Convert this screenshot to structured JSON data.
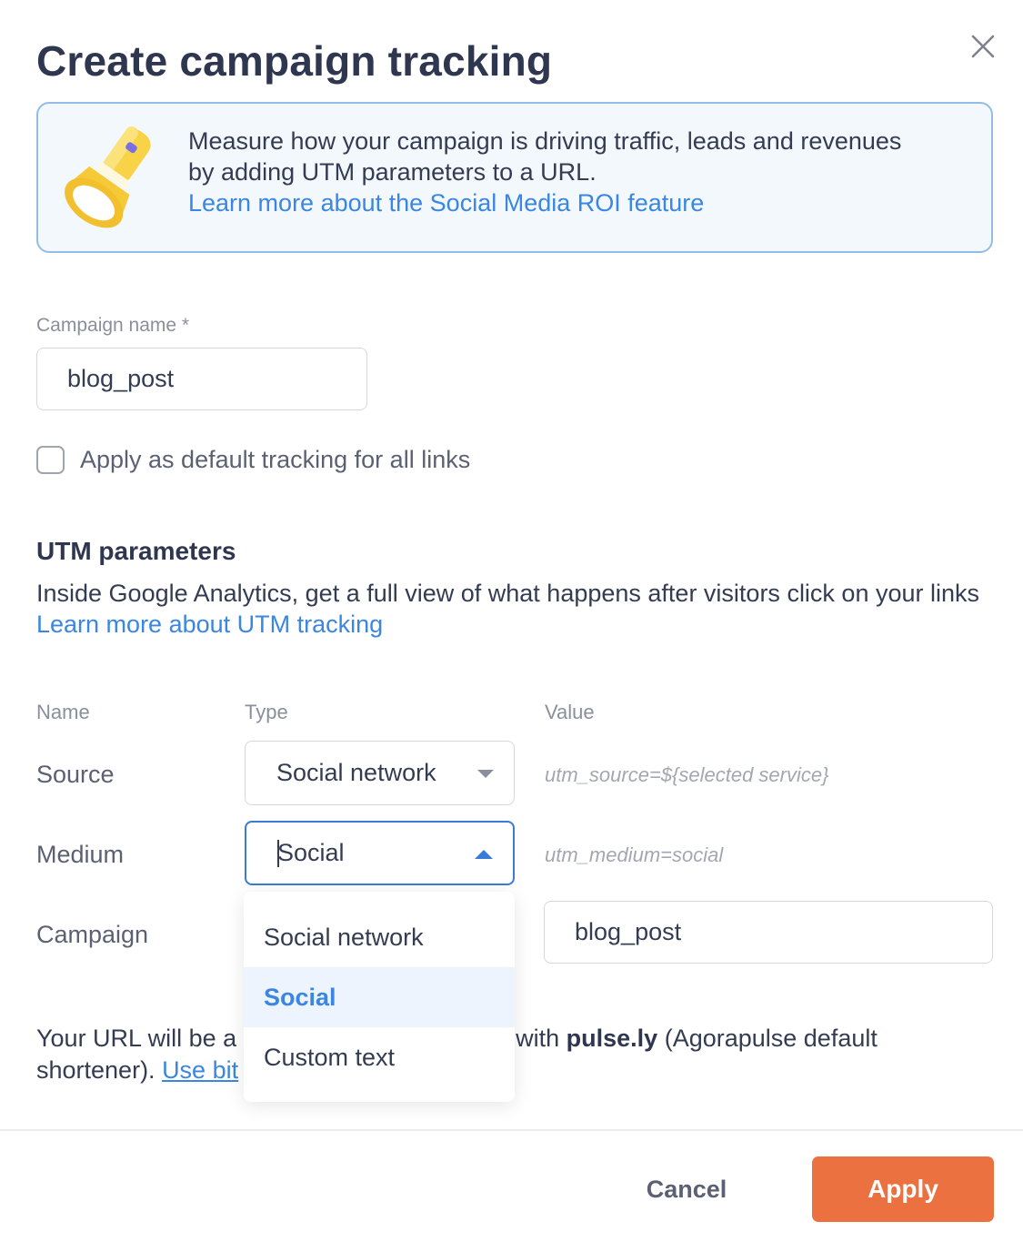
{
  "dialog": {
    "title": "Create campaign tracking",
    "close_icon": "close-icon"
  },
  "info_banner": {
    "icon": "flashlight-icon",
    "text_line1": "Measure how your campaign is driving traffic, leads and revenues",
    "text_line2": "by adding UTM parameters to a URL.",
    "link": "Learn more about the Social Media ROI feature"
  },
  "campaign_name": {
    "label": "Campaign name *",
    "value": "blog_post"
  },
  "default_tracking": {
    "label": "Apply as default tracking for all links",
    "checked": false
  },
  "utm": {
    "heading": "UTM parameters",
    "description": "Inside Google Analytics, get a full view of what happens after visitors click on your links",
    "link": "Learn more about UTM tracking",
    "columns": [
      "Name",
      "Type",
      "Value"
    ],
    "rows": [
      {
        "name": "Source",
        "type": "Social network",
        "value": "utm_source=${selected service}"
      },
      {
        "name": "Medium",
        "type": "Social",
        "value": "utm_medium=social"
      },
      {
        "name": "Campaign",
        "type": "",
        "value": "blog_post"
      }
    ],
    "medium_dropdown": {
      "options": [
        "Social network",
        "Social",
        "Custom text"
      ],
      "selected": "Social"
    }
  },
  "url_note": {
    "part1": "Your URL will be a",
    "part2": "with ",
    "bold": "pulse.ly",
    "part3": " (Agorapulse default",
    "line2_prefix": "shortener). ",
    "link": "Use bit"
  },
  "footer": {
    "cancel_label": "Cancel",
    "apply_label": "Apply",
    "accent_color": "#ec7140",
    "link_color": "#3a86e0"
  }
}
